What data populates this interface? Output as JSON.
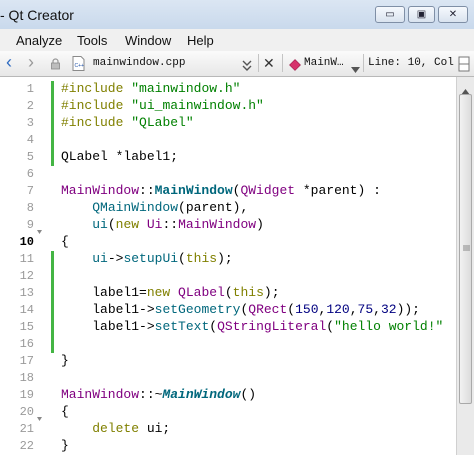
{
  "window": {
    "title": "- Qt Creator",
    "controls": {
      "minimize": "▭",
      "maximize": "▣",
      "close": "✕"
    }
  },
  "menu": [
    "Analyze",
    "Tools",
    "Window",
    "Help"
  ],
  "toolbar": {
    "back": "‹",
    "forward": "›",
    "file_name": "mainwindow.cpp",
    "close": "✕",
    "symbol": "MainW…",
    "position": "Line: 10, Col"
  },
  "editor": {
    "current_line": 10,
    "line_numbers": [
      "1",
      "2",
      "3",
      "4",
      "5",
      "6",
      "7",
      "8",
      "9",
      "10",
      "11",
      "12",
      "13",
      "14",
      "15",
      "16",
      "17",
      "18",
      "19",
      "20",
      "21",
      "22"
    ]
  },
  "code": {
    "l1": {
      "pre": "#include",
      "str": "\"mainwindow.h\""
    },
    "l2": {
      "pre": "#include",
      "str": "\"ui_mainwindow.h\""
    },
    "l3": {
      "pre": "#include",
      "str": "\"QLabel\""
    },
    "l5": {
      "type": "QLabel",
      "rest": " *label1;"
    },
    "l7": {
      "cls": "MainWindow",
      "scope": "::",
      "ctor": "MainWindow",
      "open": "(",
      "ptype": "QWidget",
      "rest": " *parent) :"
    },
    "l8": {
      "fn": "QMainWindow",
      "rest": "(parent),"
    },
    "l9": {
      "fn": "ui",
      "open": "(",
      "kw": "new",
      "sp": " ",
      "ns": "Ui",
      "scope": "::",
      "cls": "MainWindow",
      "close": ")"
    },
    "l10": {
      "text": "{"
    },
    "l11": {
      "obj": "ui",
      "arrow": "->",
      "fn": "setupUi",
      "open": "(",
      "kw": "this",
      "close": ");"
    },
    "l13": {
      "var": "label1=",
      "kw": "new",
      "sp": " ",
      "cls": "QLabel",
      "open": "(",
      "kw2": "this",
      "close": ");"
    },
    "l14": {
      "var": "label1->",
      "fn": "setGeometry",
      "open": "(",
      "cls": "QRect",
      "open2": "(",
      "n1": "150",
      "c1": ",",
      "n2": "120",
      "c2": ",",
      "n3": "75",
      "c3": ",",
      "n4": "32",
      "close": "));"
    },
    "l15": {
      "var": "label1->",
      "fn": "setText",
      "open": "(",
      "cls": "QStringLiteral",
      "open2": "(",
      "str": "\"hello world!\""
    },
    "l17": {
      "text": "}"
    },
    "l19": {
      "cls": "MainWindow",
      "scope": "::~",
      "dtor": "MainWindow",
      "rest": "()"
    },
    "l20": {
      "text": "{"
    },
    "l21": {
      "kw": "delete",
      "rest": " ui;"
    },
    "l22": {
      "text": "}"
    }
  },
  "colors": {
    "keyword": "#808000",
    "string": "#008000",
    "type": "#800080",
    "function": "#00677c",
    "number": "#000080",
    "change_bar": "#44b544"
  }
}
